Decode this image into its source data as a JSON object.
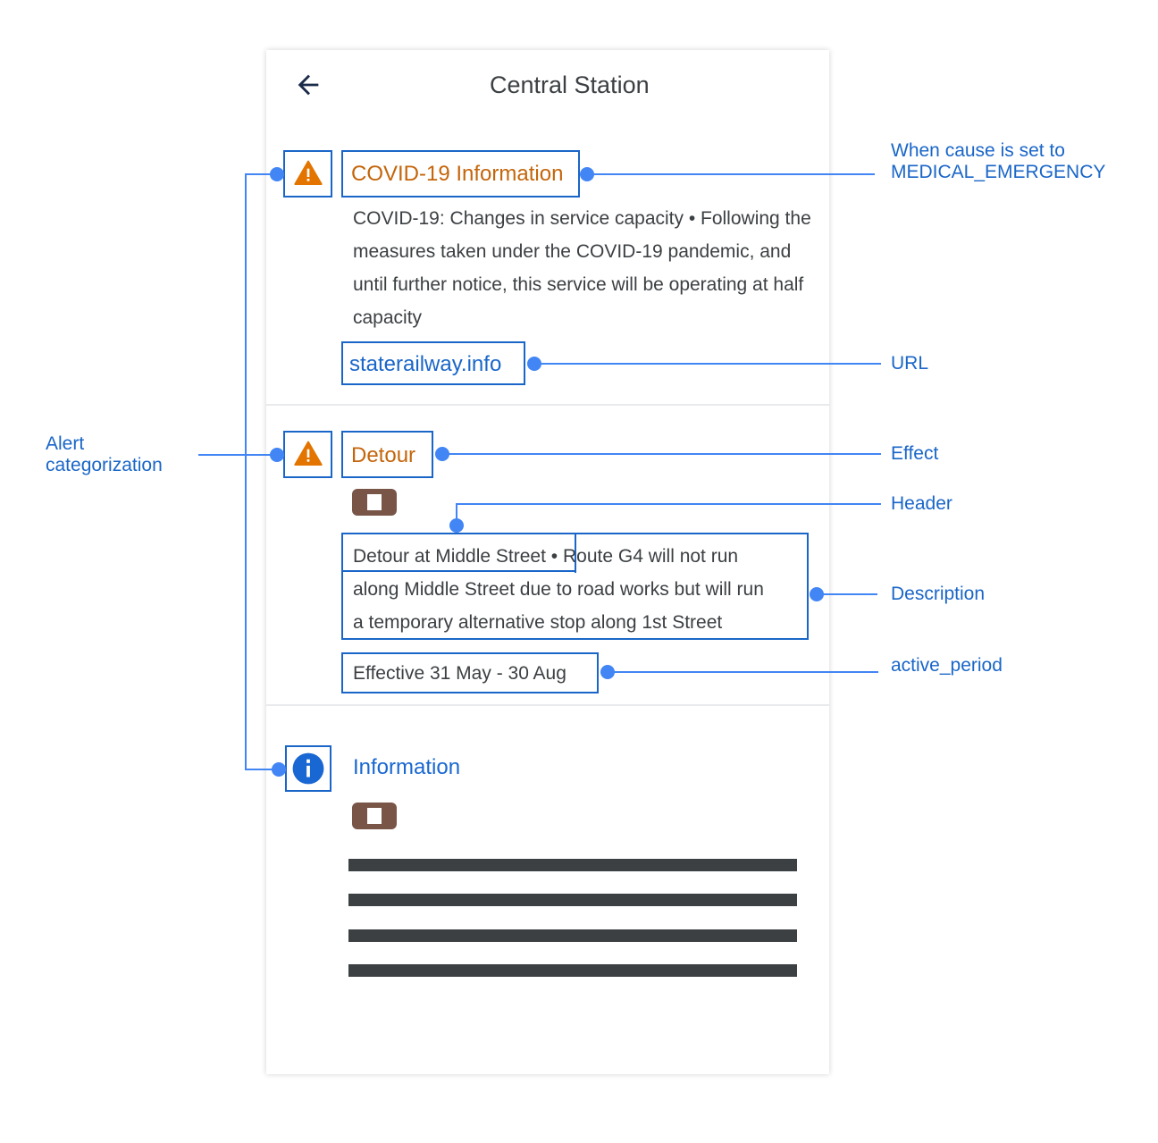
{
  "screen": {
    "title": "Central Station",
    "back_icon": "arrow-left-icon"
  },
  "alerts": [
    {
      "effect": "COVID-19 Information",
      "icon": "warning-triangle-icon",
      "description": "COVID-19: Changes in service capacity • Following the measures taken under the COVID-19 pandemic, and until further notice, this service will be operating at half capacity",
      "url": "staterailway.info"
    },
    {
      "effect": "Detour",
      "icon": "warning-triangle-icon",
      "route_badge_icon": "transit-route-badge-icon",
      "header": "Detour at Middle Street",
      "separator": "•",
      "description_line1": "Route G4 will not run",
      "description_line2": "along Middle Street due to road works but will run",
      "description_line3": "a temporary alternative stop along 1st Street",
      "active_period": "Effective 31 May - 30 Aug"
    },
    {
      "effect": "Information",
      "icon": "info-circle-icon",
      "route_badge_icon": "transit-route-badge-icon",
      "placeholder_lines": 4
    }
  ],
  "annotations": {
    "cause": "When cause is set to MEDICAL_EMERGENCY",
    "cause_line1": "When cause is set to",
    "cause_line2": "MEDICAL_EMERGENCY",
    "url": "URL",
    "effect": "Effect",
    "header": "Header",
    "description": "Description",
    "active_period": "active_period",
    "categorization_line1": "Alert",
    "categorization_line2": "categorization"
  },
  "colors": {
    "annotation_blue": "#1a66c8",
    "connector_blue": "#4285f4",
    "warning_orange": "#e37400",
    "effect_text_orange": "#c4650b",
    "info_blue": "#1967d2",
    "badge_brown": "#795548",
    "text_dark": "#3c4043"
  }
}
